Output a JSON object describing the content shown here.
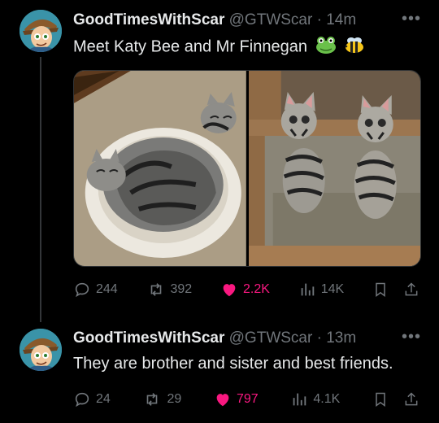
{
  "colors": {
    "background": "#000000",
    "text": "#e7e9ea",
    "muted": "#71767b",
    "like": "#f91880"
  },
  "tweets": [
    {
      "display_name": "GoodTimesWithScar",
      "handle": "@GTWScar",
      "separator": "·",
      "time": "14m",
      "text": "Meet Katy Bee and Mr Finnegan",
      "emojis": [
        "frog-emoji",
        "bee-emoji"
      ],
      "media": [
        "photo-cats-in-round-bed",
        "photo-cats-on-chair"
      ],
      "actions": {
        "replies": "244",
        "reposts": "392",
        "likes": "2.2K",
        "views": "14K",
        "liked": true
      }
    },
    {
      "display_name": "GoodTimesWithScar",
      "handle": "@GTWScar",
      "separator": "·",
      "time": "13m",
      "text": "They are brother and sister and best friends.",
      "actions": {
        "replies": "24",
        "reposts": "29",
        "likes": "797",
        "views": "4.1K",
        "liked": true
      }
    }
  ]
}
